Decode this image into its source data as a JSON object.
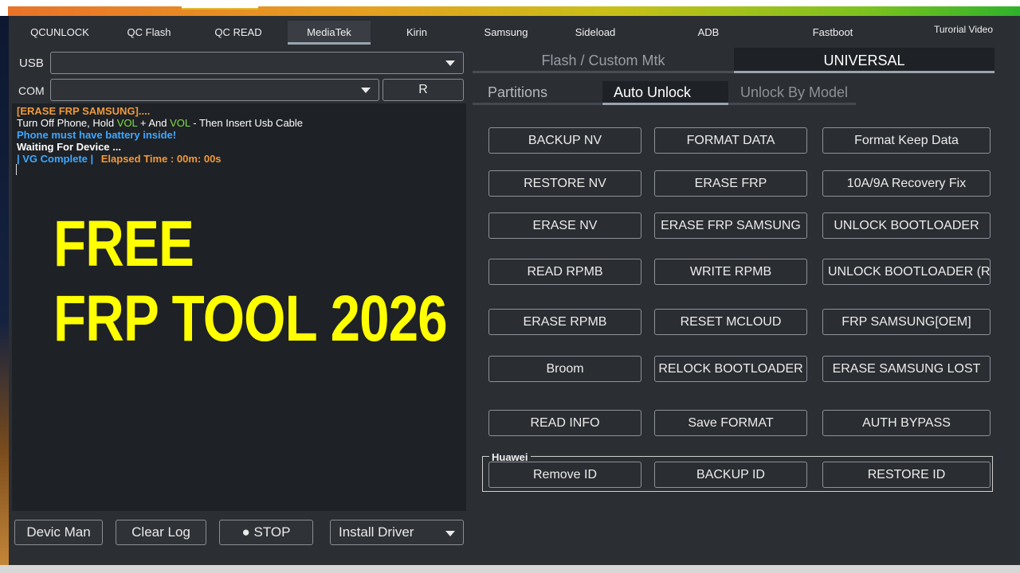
{
  "tabs": [
    "QCUNLOCK",
    "QC Flash",
    "QC READ",
    "MediaTek",
    "Kirin",
    "Samsung",
    "Sideload",
    "ADB",
    "Fastboot"
  ],
  "tutorial_label": "Turorial Video",
  "usb_label": "USB",
  "com_label": "COM",
  "refresh_label": "R",
  "log": {
    "line1": " [ERASE FRP SAMSUNG]....",
    "line2_a": "Turn Off Phone, Hold ",
    "vol": "VOL",
    "line2_b": " + And ",
    "line2_c": " - Then Insert Usb Cable",
    "line3": "Phone must have battery inside!",
    "line4": "Waiting For Device ...",
    "line5_a": "| VG Complete |",
    "line5_b": "Elapsed Time : 00m: 00s"
  },
  "overlay": {
    "line1": "FREE",
    "line2": "FRP TOOL 2026",
    "color": "#ffff00"
  },
  "bottom_buttons": [
    "Devic Man",
    "Clear Log",
    "● STOP",
    "Install Driver"
  ],
  "right_tabs": {
    "flash": "Flash / Custom Mtk",
    "universal": "UNIVERSAL"
  },
  "sub_tabs": [
    "Partitions",
    "Auto Unlock",
    "Unlock By Model"
  ],
  "buttons": {
    "backup_nv": "BACKUP NV",
    "format_data": "FORMAT DATA",
    "format_keep": "Format Keep Data",
    "restore_nv": "RESTORE NV",
    "erase_frp": "ERASE FRP",
    "recovery_fix": "10A/9A Recovery Fix",
    "erase_nv": "ERASE NV",
    "erase_frp_samsung": "ERASE FRP SAMSUNG",
    "unlock_bl": "UNLOCK BOOTLOADER",
    "read_rpmb": "READ RPMB",
    "write_rpmb": "WRITE RPMB",
    "unlock_bl_re": "UNLOCK BOOTLOADER (Re",
    "erase_rpmb": "ERASE RPMB",
    "reset_mcloud": "RESET MCLOUD",
    "frp_samsung_oem": "FRP SAMSUNG[OEM]",
    "broom": "Broom",
    "relock_bl": "RELOCK BOOTLOADER",
    "erase_samsung_lost": "ERASE SAMSUNG LOST",
    "read_info": "READ INFO",
    "save_format": "Save FORMAT",
    "auth_bypass": "AUTH BYPASS"
  },
  "huawei": {
    "title": "Huawei",
    "remove_id": "Remove ID",
    "backup_id": "BACKUP ID",
    "restore_id": "RESTORE ID"
  },
  "colors": {
    "log_orange": "#f09a3a",
    "log_green": "#7fe043",
    "log_blue": "#3fa8ff",
    "title_gradient_start": "#e8732a",
    "title_gradient_end": "#2fb22c"
  }
}
